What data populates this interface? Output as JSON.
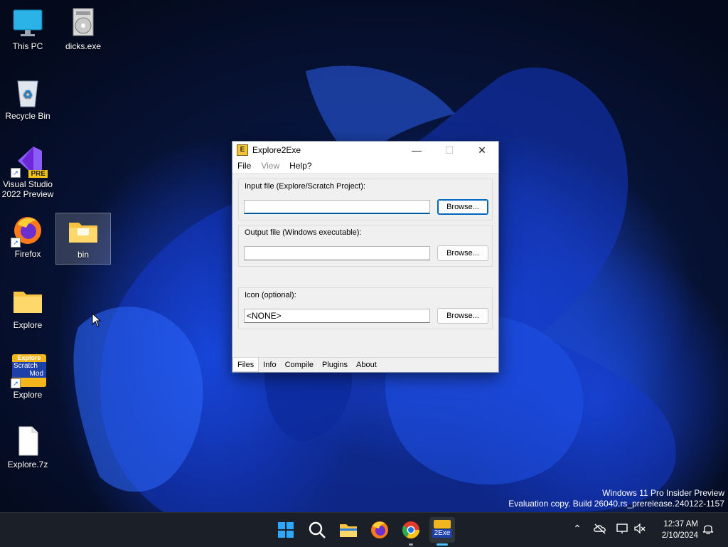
{
  "desktop": {
    "icons": [
      {
        "label": "This PC",
        "icon": "monitor-icon"
      },
      {
        "label": "dicks.exe",
        "icon": "installer-icon"
      },
      {
        "label": "Recycle Bin",
        "icon": "recycle-bin-icon"
      },
      {
        "label": "Visual Studio 2022 Preview",
        "icon": "visual-studio-icon",
        "badge": "PRE"
      },
      {
        "label": "Firefox",
        "icon": "firefox-icon"
      },
      {
        "label": "bin",
        "icon": "folder-icon"
      },
      {
        "label": "Explore",
        "icon": "folder-icon"
      },
      {
        "label": "Explore",
        "icon": "scratch-mod-icon",
        "art_text": [
          "Explore",
          "Scratch",
          "Mod"
        ]
      },
      {
        "label": "Explore.7z",
        "icon": "file-icon"
      }
    ]
  },
  "window": {
    "title": "Explore2Exe",
    "minimize": "—",
    "maximize": "☐",
    "close": "✕",
    "menu": {
      "file": "File",
      "view": "View",
      "help": "Help?"
    },
    "input_group": {
      "label": "Input file (Explore/Scratch Project):",
      "value": "",
      "browse": "Browse..."
    },
    "output_group": {
      "label": "Output file (Windows executable):",
      "value": "",
      "browse": "Browse..."
    },
    "icon_group": {
      "label": "Icon (optional):",
      "value": "<NONE>",
      "browse": "Browse..."
    },
    "tabs": [
      "Files",
      "Info",
      "Compile",
      "Plugins",
      "About"
    ]
  },
  "watermark": {
    "line1": "Windows 11 Pro Insider Preview",
    "line2": "Evaluation copy. Build 26040.rs_prerelease.240122-1157"
  },
  "taskbar": {
    "apps": [
      "start-icon",
      "search-icon",
      "file-explorer-icon",
      "firefox-icon",
      "chrome-icon",
      "explore2exe-icon"
    ],
    "explore2exe_label": "2Exe",
    "time": "12:37 AM",
    "date": "2/10/2024"
  }
}
